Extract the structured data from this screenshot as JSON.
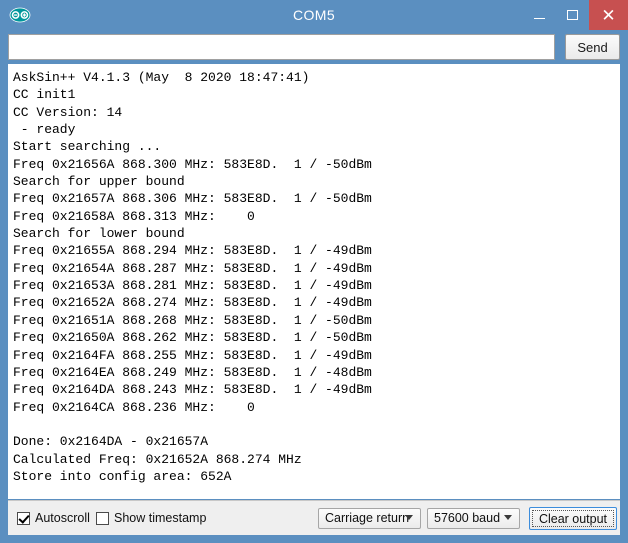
{
  "window": {
    "title": "COM5",
    "logo_icon": "arduino-infinity-logo",
    "titlebar_color": "#5b8fc0",
    "close_button_color": "#c75050",
    "controls": {
      "minimize_icon": "minimize-icon",
      "maximize_icon": "maximize-icon",
      "close_icon": "close-icon"
    }
  },
  "send_row": {
    "input_value": "",
    "input_placeholder": "",
    "send_label": "Send"
  },
  "console": {
    "lines": [
      "AskSin++ V4.1.3 (May  8 2020 18:47:41)",
      "CC init1",
      "CC Version: 14",
      " - ready",
      "Start searching ...",
      "Freq 0x21656A 868.300 MHz: 583E8D.  1 / -50dBm",
      "Search for upper bound",
      "Freq 0x21657A 868.306 MHz: 583E8D.  1 / -50dBm",
      "Freq 0x21658A 868.313 MHz:    0",
      "Search for lower bound",
      "Freq 0x21655A 868.294 MHz: 583E8D.  1 / -49dBm",
      "Freq 0x21654A 868.287 MHz: 583E8D.  1 / -49dBm",
      "Freq 0x21653A 868.281 MHz: 583E8D.  1 / -49dBm",
      "Freq 0x21652A 868.274 MHz: 583E8D.  1 / -49dBm",
      "Freq 0x21651A 868.268 MHz: 583E8D.  1 / -50dBm",
      "Freq 0x21650A 868.262 MHz: 583E8D.  1 / -50dBm",
      "Freq 0x2164FA 868.255 MHz: 583E8D.  1 / -49dBm",
      "Freq 0x2164EA 868.249 MHz: 583E8D.  1 / -48dBm",
      "Freq 0x2164DA 868.243 MHz: 583E8D.  1 / -49dBm",
      "Freq 0x2164CA 868.236 MHz:    0",
      "",
      "Done: 0x2164DA - 0x21657A",
      "Calculated Freq: 0x21652A 868.274 MHz",
      "Store into config area: 652A"
    ]
  },
  "footer": {
    "autoscroll_label": "Autoscroll",
    "autoscroll_checked": true,
    "timestamp_label": "Show timestamp",
    "timestamp_checked": false,
    "line_ending_value": "Carriage return",
    "baud_value": "57600 baud",
    "clear_output_label": "Clear output",
    "focus_color": "#3c8ddc"
  }
}
